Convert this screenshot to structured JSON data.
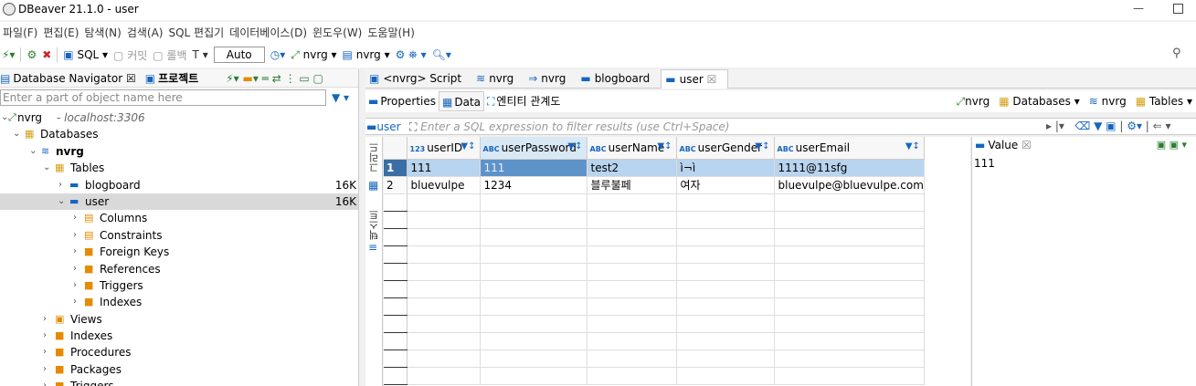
{
  "window": {
    "title": "DBeaver 21.1.0 - user"
  },
  "menu": [
    "파일(F)",
    "편집(E)",
    "탐색(N)",
    "검색(A)",
    "SQL 편집기",
    "데이터베이스(D)",
    "윈도우(W)",
    "도움말(H)"
  ],
  "toolbar": {
    "sql_label": "SQL",
    "commit_label": "커밋",
    "rollback_label": "롤백",
    "auto_label": "Auto",
    "connection1": "nvrg",
    "connection2": "nvrg"
  },
  "navigator": {
    "tab1": "Database Navigator",
    "tab2": "프로젝트",
    "filter_placeholder": "Enter a part of object name here",
    "tree": [
      {
        "label": "nvrg",
        "suffix": "- localhost:3306"
      },
      {
        "label": "Databases"
      },
      {
        "label": "nvrg"
      },
      {
        "label": "Tables"
      },
      {
        "label": "blogboard",
        "size": "16K"
      },
      {
        "label": "user",
        "size": "16K"
      },
      {
        "label": "Columns"
      },
      {
        "label": "Constraints"
      },
      {
        "label": "Foreign Keys"
      },
      {
        "label": "References"
      },
      {
        "label": "Triggers"
      },
      {
        "label": "Indexes"
      },
      {
        "label": "Views"
      },
      {
        "label": "Indexes"
      },
      {
        "label": "Procedures"
      },
      {
        "label": "Packages"
      },
      {
        "label": "Triggers"
      }
    ]
  },
  "editor_tabs": [
    {
      "label": "<nvrg> Script"
    },
    {
      "label": "nvrg"
    },
    {
      "label": "nvrg"
    },
    {
      "label": "blogboard"
    },
    {
      "label": "user"
    }
  ],
  "subtabs": {
    "properties": "Properties",
    "data": "Data",
    "er": "엔티티 관계도",
    "right_conn": "nvrg",
    "right_databases": "Databases",
    "right_db": "nvrg",
    "right_tables": "Tables"
  },
  "filter": {
    "table": "user",
    "placeholder": "Enter a SQL expression to filter results (use Ctrl+Space)"
  },
  "side_tabs": {
    "grid": "그리드",
    "text": "텍스트"
  },
  "grid": {
    "columns": [
      "userID",
      "userPassword",
      "userName",
      "userGender",
      "userEmail"
    ],
    "rows": [
      {
        "num": "1",
        "cells": [
          "111",
          "111",
          "test2",
          "ì¬ì",
          "1111@11sfg"
        ]
      },
      {
        "num": "2",
        "cells": [
          "bluevulpe",
          "1234",
          "블루불페",
          "여자",
          "bluevulpe@bluevulpe.com"
        ]
      }
    ]
  },
  "value_panel": {
    "tab": "Value",
    "value": "111"
  }
}
